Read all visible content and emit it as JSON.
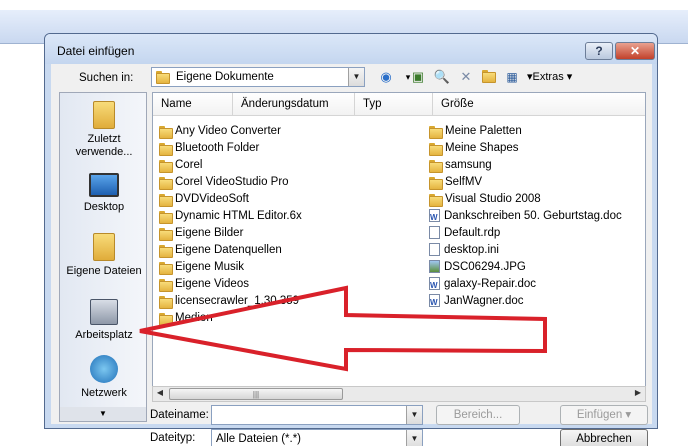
{
  "dialog": {
    "title": "Datei einfügen"
  },
  "toolbar": {
    "look_in_label": "Suchen in:",
    "look_in_value": "Eigene Dokumente",
    "extras_label": "Extras"
  },
  "places": [
    {
      "label": "Zuletzt verwende...",
      "icon": "recent-folder-icon"
    },
    {
      "label": "Desktop",
      "icon": "desktop-icon"
    },
    {
      "label": "Eigene Dateien",
      "icon": "documents-folder-icon"
    },
    {
      "label": "Arbeitsplatz",
      "icon": "computer-icon"
    },
    {
      "label": "Netzwerk",
      "icon": "network-icon"
    }
  ],
  "columns": [
    "Name",
    "Änderungsdatum",
    "Typ",
    "Größe"
  ],
  "files_left": [
    {
      "name": "Any Video Converter",
      "icon": "folder"
    },
    {
      "name": "Bluetooth Folder",
      "icon": "folder"
    },
    {
      "name": "Corel",
      "icon": "folder"
    },
    {
      "name": "Corel VideoStudio Pro",
      "icon": "folder"
    },
    {
      "name": "DVDVideoSoft",
      "icon": "folder"
    },
    {
      "name": "Dynamic HTML Editor.6x",
      "icon": "folder"
    },
    {
      "name": "Eigene Bilder",
      "icon": "folder"
    },
    {
      "name": "Eigene Datenquellen",
      "icon": "folder"
    },
    {
      "name": "Eigene Musik",
      "icon": "folder"
    },
    {
      "name": "Eigene Videos",
      "icon": "folder"
    },
    {
      "name": "licensecrawler_1.30.359",
      "icon": "folder"
    },
    {
      "name": "Medion",
      "icon": "folder"
    }
  ],
  "files_right": [
    {
      "name": "Meine Paletten",
      "icon": "folder"
    },
    {
      "name": "Meine Shapes",
      "icon": "folder"
    },
    {
      "name": "samsung",
      "icon": "folder"
    },
    {
      "name": "SelfMV",
      "icon": "folder"
    },
    {
      "name": "Visual Studio 2008",
      "icon": "folder"
    },
    {
      "name": "Dankschreiben 50. Geburtstag.doc",
      "icon": "word"
    },
    {
      "name": "Default.rdp",
      "icon": "doc"
    },
    {
      "name": "desktop.ini",
      "icon": "doc"
    },
    {
      "name": "DSC06294.JPG",
      "icon": "img"
    },
    {
      "name": "galaxy-Repair.doc",
      "icon": "word"
    },
    {
      "name": "JanWagner.doc",
      "icon": "word"
    }
  ],
  "bottom": {
    "filename_label": "Dateiname:",
    "filename_value": "",
    "filetype_label": "Dateityp:",
    "filetype_value": "Alle Dateien (*.*)",
    "range_button": "Bereich...",
    "insert_button": "Einfügen",
    "cancel_button": "Abbrechen"
  },
  "colors": {
    "arrow": "#d9212a",
    "accent": "#c8d9f0"
  }
}
